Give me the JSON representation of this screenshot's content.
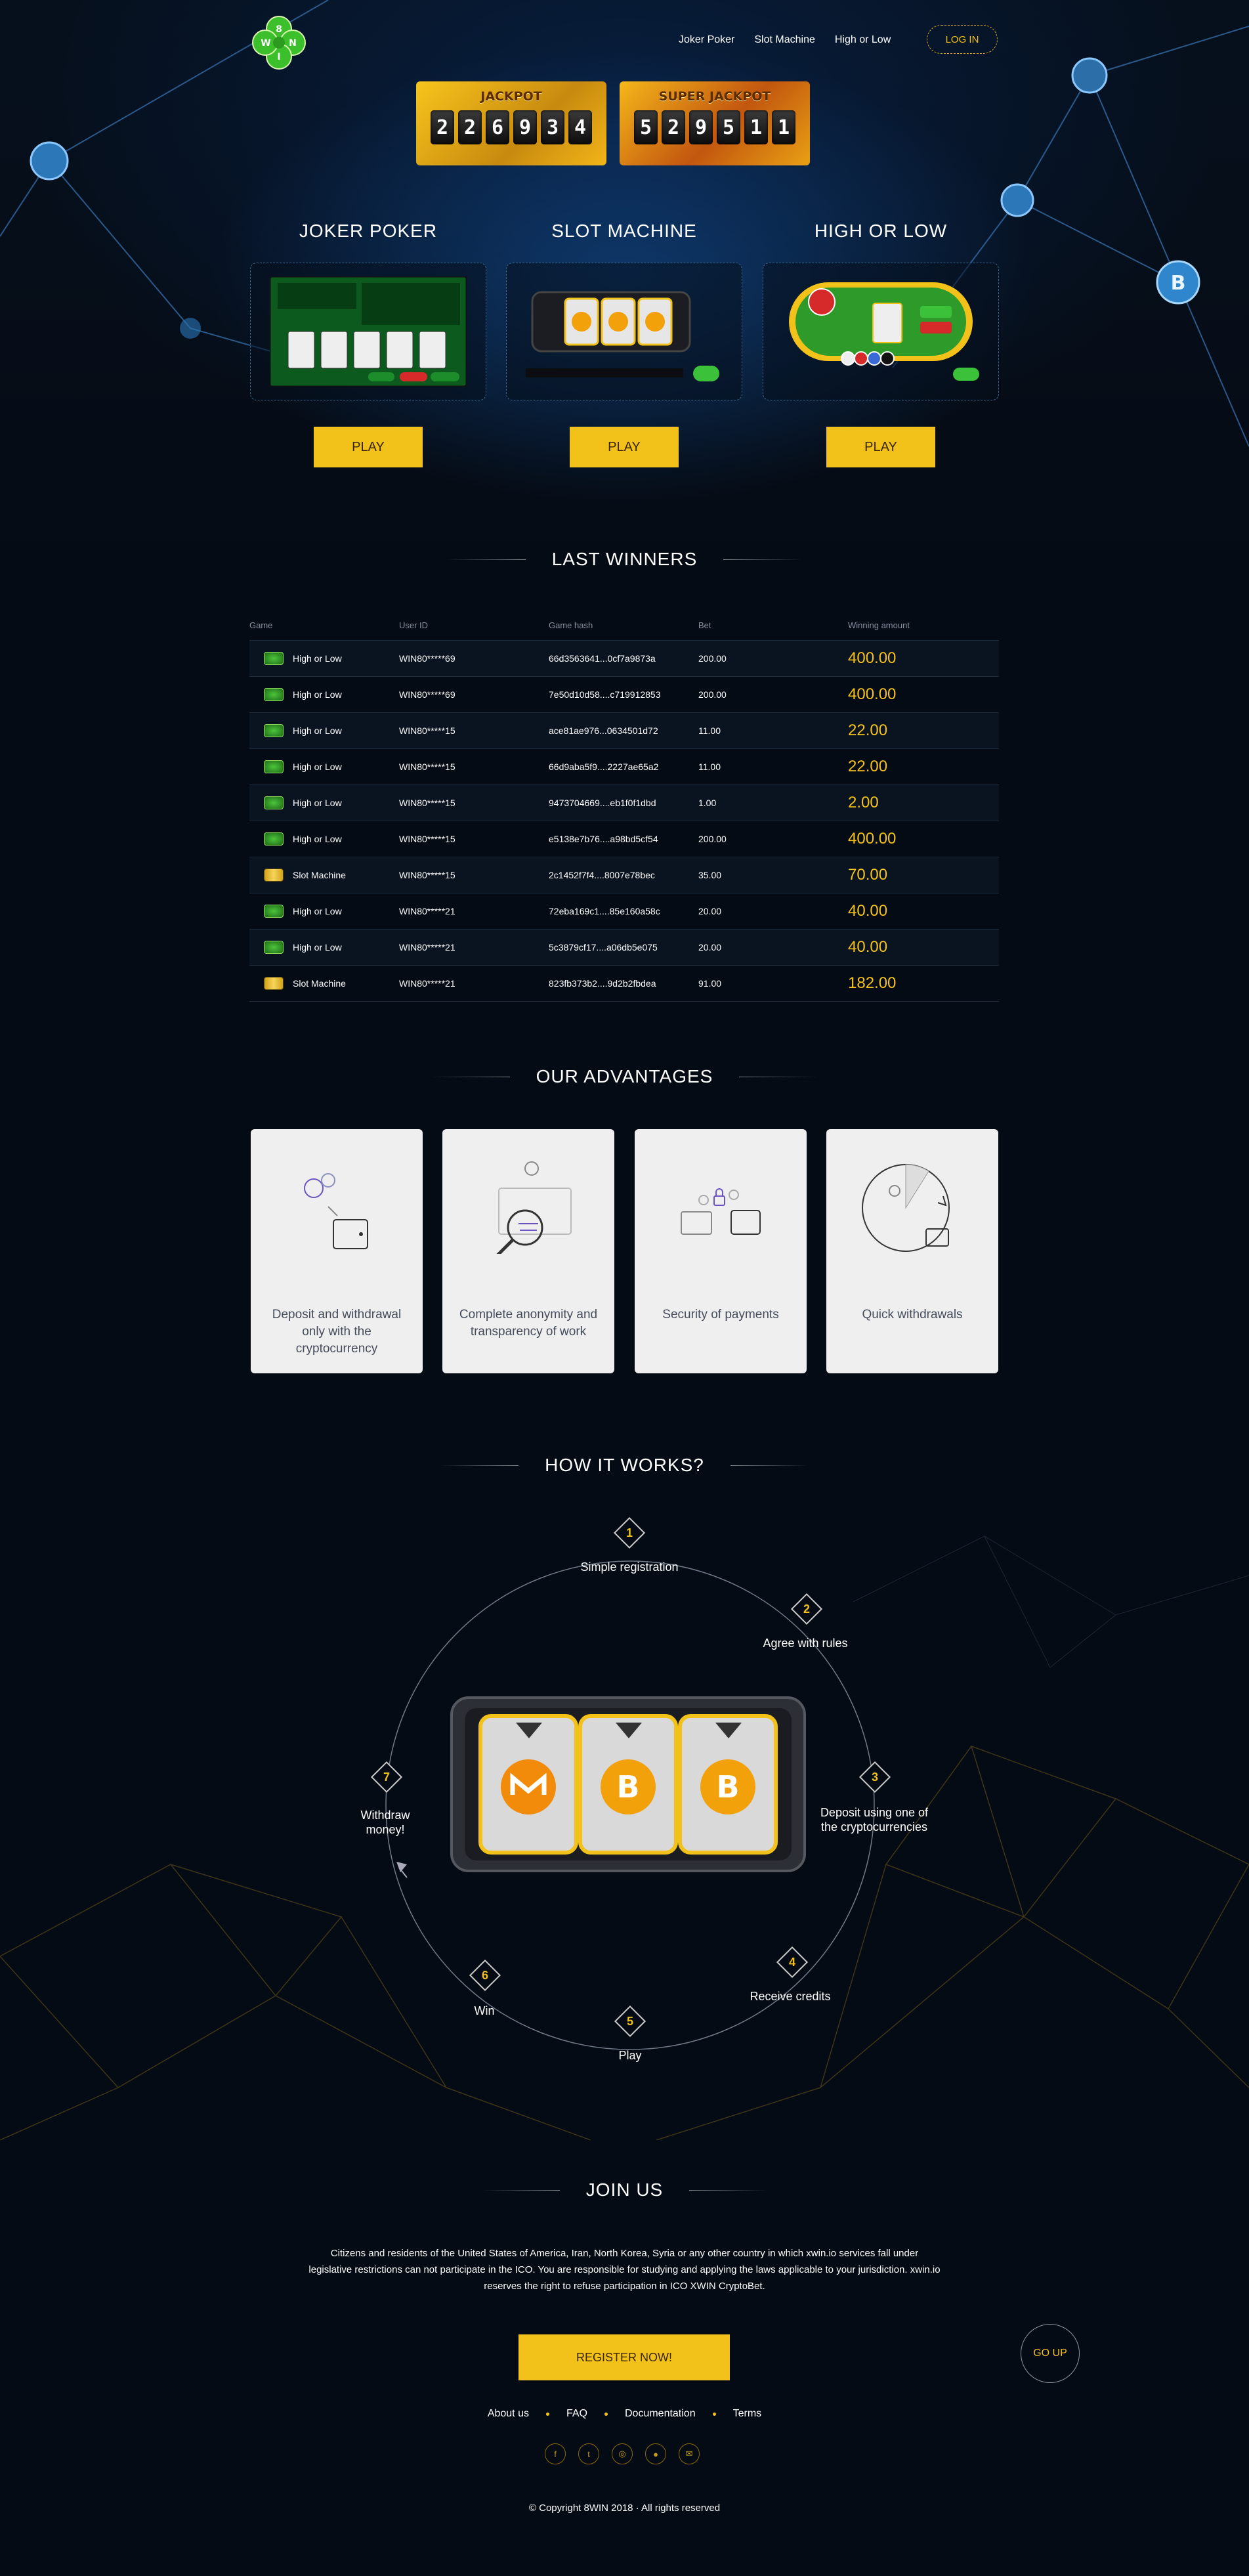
{
  "header": {
    "logo_letters": [
      "8",
      "W",
      "I",
      "N"
    ],
    "nav": [
      "Joker Poker",
      "Slot Machine",
      "High or Low"
    ],
    "login_label": "LOG IN"
  },
  "jackpots": [
    {
      "title": "JACKPOT",
      "digits": [
        "2",
        "2",
        "6",
        "9",
        "3",
        "4"
      ]
    },
    {
      "title": "SUPER JACKPOT",
      "digits": [
        "5",
        "2",
        "9",
        "5",
        "1",
        "1"
      ]
    }
  ],
  "games": [
    {
      "title": "JOKER POKER",
      "play": "PLAY"
    },
    {
      "title": "SLOT MACHINE",
      "play": "PLAY"
    },
    {
      "title": "HIGH OR LOW",
      "play": "PLAY"
    }
  ],
  "winners": {
    "heading": "LAST WINNERS",
    "columns": [
      "Game",
      "User ID",
      "Game hash",
      "Bet",
      "Winning amount"
    ],
    "rows": [
      {
        "game": "High or Low",
        "type": "hl",
        "user": "WIN80*****69",
        "hash": "66d3563641...0cf7a9873a",
        "bet": "200.00",
        "win": "400.00"
      },
      {
        "game": "High or Low",
        "type": "hl",
        "user": "WIN80*****69",
        "hash": "7e50d10d58....c719912853",
        "bet": "200.00",
        "win": "400.00"
      },
      {
        "game": "High or Low",
        "type": "hl",
        "user": "WIN80*****15",
        "hash": "ace81ae976...0634501d72",
        "bet": "11.00",
        "win": "22.00"
      },
      {
        "game": "High or Low",
        "type": "hl",
        "user": "WIN80*****15",
        "hash": "66d9aba5f9....2227ae65a2",
        "bet": "11.00",
        "win": "22.00"
      },
      {
        "game": "High or Low",
        "type": "hl",
        "user": "WIN80*****15",
        "hash": "9473704669....eb1f0f1dbd",
        "bet": "1.00",
        "win": "2.00"
      },
      {
        "game": "High or Low",
        "type": "hl",
        "user": "WIN80*****15",
        "hash": "e5138e7b76....a98bd5cf54",
        "bet": "200.00",
        "win": "400.00"
      },
      {
        "game": "Slot Machine",
        "type": "sm",
        "user": "WIN80*****15",
        "hash": "2c1452f7f4....8007e78bec",
        "bet": "35.00",
        "win": "70.00"
      },
      {
        "game": "High or Low",
        "type": "hl",
        "user": "WIN80*****21",
        "hash": "72eba169c1....85e160a58c",
        "bet": "20.00",
        "win": "40.00"
      },
      {
        "game": "High or Low",
        "type": "hl",
        "user": "WIN80*****21",
        "hash": "5c3879cf17....a06db5e075",
        "bet": "20.00",
        "win": "40.00"
      },
      {
        "game": "Slot Machine",
        "type": "sm",
        "user": "WIN80*****21",
        "hash": "823fb373b2....9d2b2fbdea",
        "bet": "91.00",
        "win": "182.00"
      }
    ]
  },
  "advantages": {
    "heading": "OUR ADVANTAGES",
    "items": [
      {
        "icon": "crypto-wallet-icon",
        "text": "Deposit and withdrawal only with the cryptocurrency"
      },
      {
        "icon": "anonymity-magnifier-icon",
        "text": "Complete anonymity and transparency of work"
      },
      {
        "icon": "secure-payment-icon",
        "text": "Security of payments"
      },
      {
        "icon": "quick-withdrawal-icon",
        "text": "Quick withdrawals"
      }
    ]
  },
  "how_it_works": {
    "heading": "HOW IT WORKS?",
    "steps": [
      {
        "n": "1",
        "label": "Simple registration"
      },
      {
        "n": "2",
        "label": "Agree with rules"
      },
      {
        "n": "3",
        "label": "Deposit using one of the cryptocurrencies"
      },
      {
        "n": "4",
        "label": "Receive credits"
      },
      {
        "n": "5",
        "label": "Play"
      },
      {
        "n": "6",
        "label": "Win"
      },
      {
        "n": "7",
        "label": "Withdraw money!"
      }
    ]
  },
  "join": {
    "heading": "JOIN US",
    "text": "Citizens and residents of the United States of America, Iran, North Korea, Syria or any other country in which xwin.io services fall under legislative restrictions can not participate in the ICO. You are responsible for studying and applying the laws applicable to your jurisdiction. xwin.io reserves the right to refuse participation in ICO XWIN CryptoBet.",
    "register_label": "REGISTER NOW!",
    "goup_label": "GO UP"
  },
  "footer": {
    "links": [
      "About us",
      "FAQ",
      "Documentation",
      "Terms"
    ],
    "social": [
      {
        "icon": "facebook-icon",
        "glyph": "f"
      },
      {
        "icon": "twitter-icon",
        "glyph": "t"
      },
      {
        "icon": "instagram-icon",
        "glyph": "◎"
      },
      {
        "icon": "github-icon",
        "glyph": "●"
      },
      {
        "icon": "chat-icon",
        "glyph": "✉"
      }
    ],
    "copyright": "© Copyright 8WIN 2018 · All rights reserved"
  }
}
